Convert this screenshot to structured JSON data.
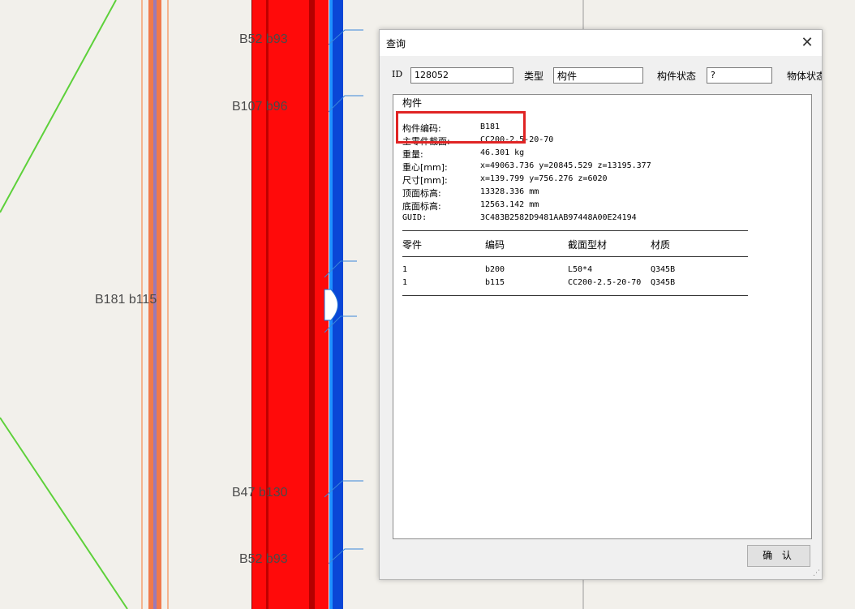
{
  "viewport": {
    "labels": [
      "B52 b93",
      "B107 b96",
      "B181 b115",
      "B47 b130",
      "B52 b93"
    ]
  },
  "dialog": {
    "title": "查询",
    "close_icon": "close-icon",
    "fields": [
      {
        "label": "ID",
        "value": "128052"
      },
      {
        "label": "类型",
        "value": "构件"
      },
      {
        "label": "构件状态",
        "value": "?"
      },
      {
        "label": "物体状态",
        "value": ""
      }
    ],
    "panel": {
      "title": "构件",
      "properties": [
        {
          "key": "构件编码:",
          "value": "B181"
        },
        {
          "key": "主零件截面:",
          "value": "CC200-2.5-20-70"
        },
        {
          "key": "重量:",
          "value": "46.301 kg"
        },
        {
          "key": "重心[mm]:",
          "value": "x=49063.736 y=20845.529 z=13195.377"
        },
        {
          "key": "尺寸[mm]:",
          "value": "x=139.799 y=756.276 z=6020"
        },
        {
          "key": "顶面标高:",
          "value": "13328.336 mm"
        },
        {
          "key": "底面标高:",
          "value": "12563.142 mm"
        },
        {
          "key": "GUID:",
          "value": "3C483B2582D9481AAB97448A00E24194"
        }
      ],
      "table": {
        "headers": [
          "零件",
          "编码",
          "截面型材",
          "材质"
        ],
        "rows": [
          [
            "1",
            "b200",
            "L50*4",
            "Q345B"
          ],
          [
            "1",
            "b115",
            "CC200-2.5-20-70",
            "Q345B"
          ]
        ]
      }
    },
    "ok_label": "确 认"
  },
  "colors": {
    "member_red": "#ff0a0a",
    "member_dark_red": "#b50000",
    "member_blue": "#0a46d6",
    "line_green": "#5dd13a",
    "line_orange": "#f07a4c",
    "highlight": "#e02424"
  }
}
